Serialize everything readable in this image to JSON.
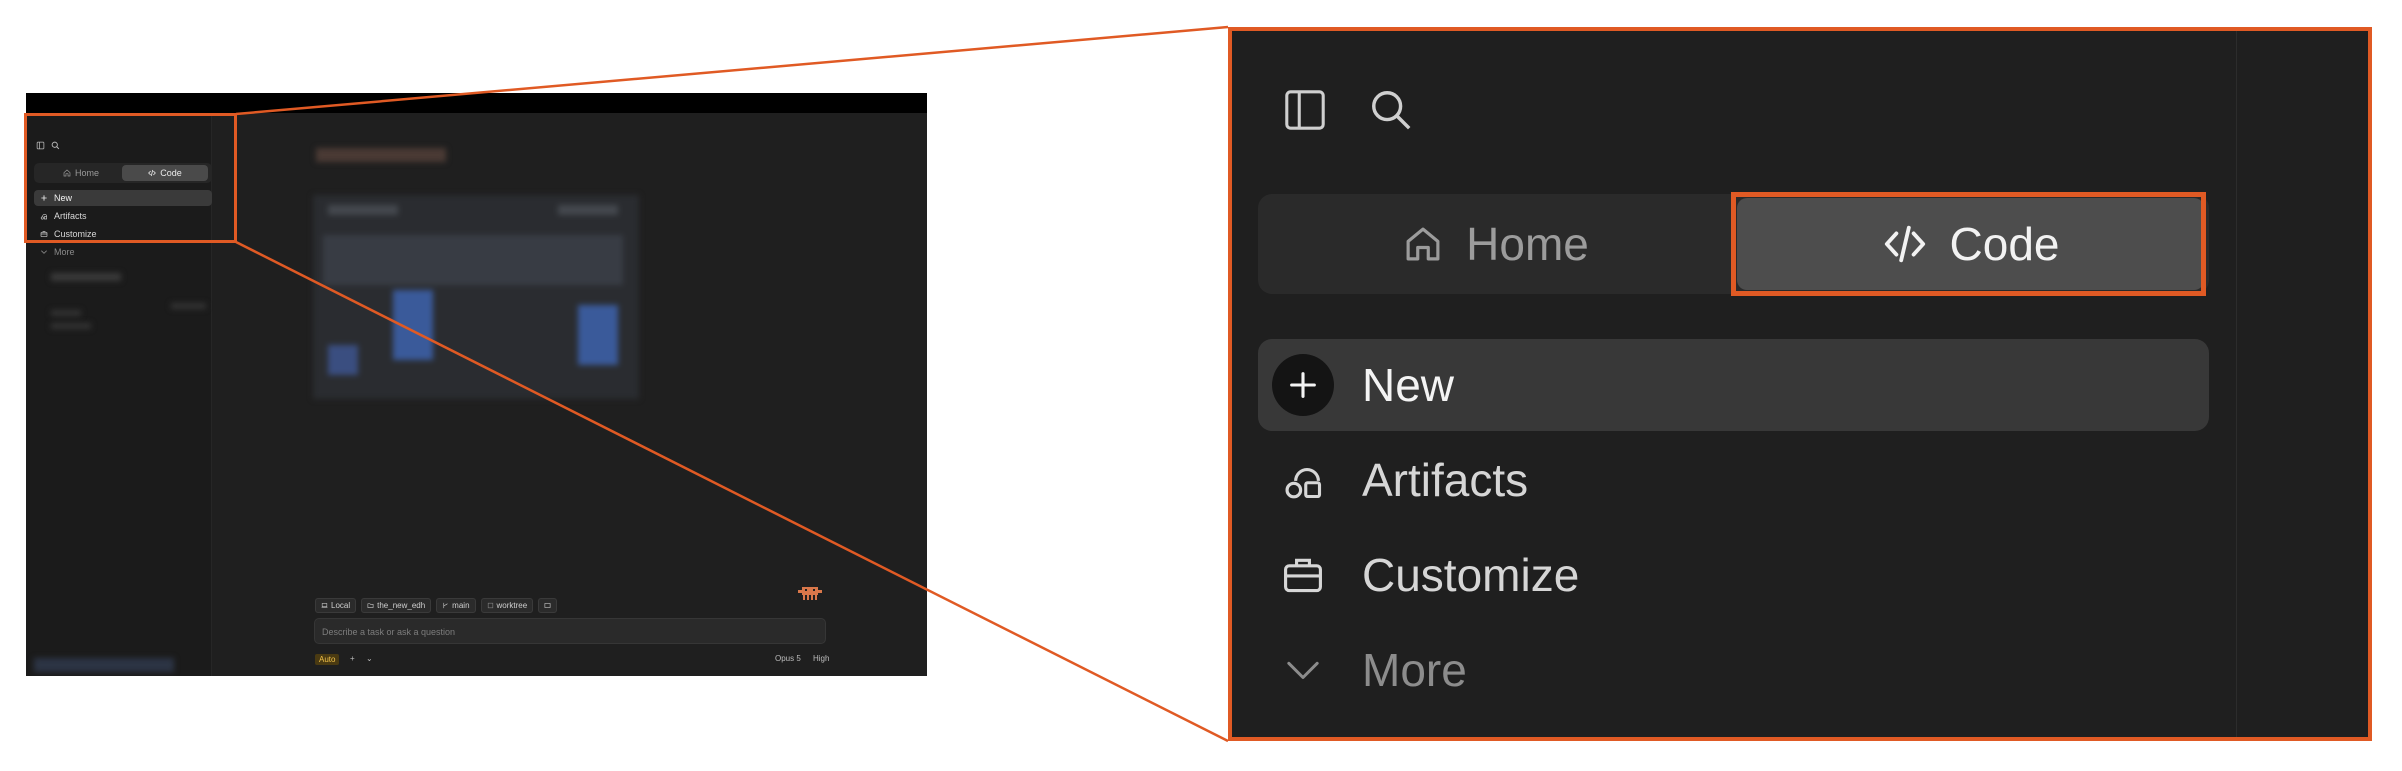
{
  "accent_color": "#e05a24",
  "sidebar": {
    "tabs": [
      {
        "label": "Home",
        "icon": "home-icon",
        "active": false
      },
      {
        "label": "Code",
        "icon": "code-icon",
        "active": true
      }
    ],
    "items": [
      {
        "label": "New",
        "icon": "plus-icon",
        "selected": true
      },
      {
        "label": "Artifacts",
        "icon": "artifacts-icon",
        "selected": false
      },
      {
        "label": "Customize",
        "icon": "briefcase-icon",
        "selected": false
      },
      {
        "label": "More",
        "icon": "chevron-down-icon",
        "selected": false
      }
    ]
  },
  "composer": {
    "chips": [
      {
        "label": "Local",
        "icon": "laptop-icon"
      },
      {
        "label": "the_new_edh",
        "icon": "folder-icon"
      },
      {
        "label": "main",
        "icon": "branch-icon"
      },
      {
        "label": "worktree",
        "icon": "worktree-icon"
      }
    ],
    "placeholder": "Describe a task or ask a question",
    "mode_badge": "Auto",
    "model": "Opus 5",
    "effort": "High"
  }
}
